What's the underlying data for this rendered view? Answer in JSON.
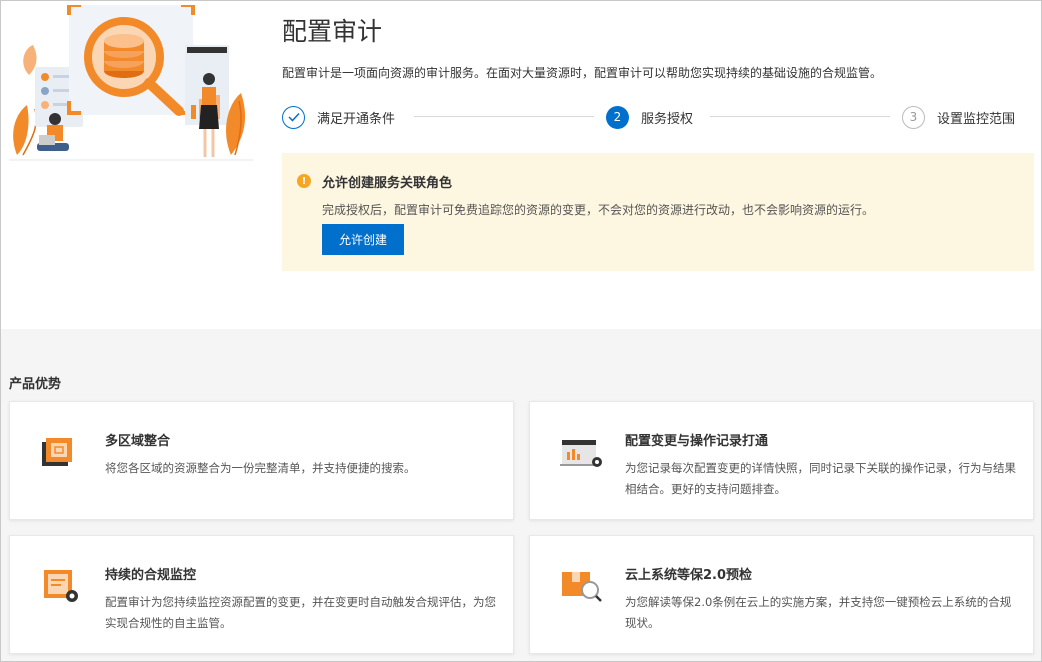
{
  "header": {
    "title": "配置审计",
    "description": "配置审计是一项面向资源的审计服务。在面对大量资源时，配置审计可以帮助您实现持续的基础设施的合规监管。"
  },
  "steps": [
    {
      "number": "1",
      "label": "满足开通条件",
      "state": "done"
    },
    {
      "number": "2",
      "label": "服务授权",
      "state": "active"
    },
    {
      "number": "3",
      "label": "设置监控范围",
      "state": "todo"
    }
  ],
  "notice": {
    "title": "允许创建服务关联角色",
    "text": "完成授权后，配置审计可免费追踪您的资源的变更，不会对您的资源进行改动，也不会影响资源的运行。",
    "button_label": "允许创建"
  },
  "advantages": {
    "title": "产品优势",
    "cards": [
      {
        "icon": "multi-region-icon",
        "title": "多区域整合",
        "desc": "将您各区域的资源整合为一份完整清单，并支持便捷的搜索。"
      },
      {
        "icon": "config-record-icon",
        "title": "配置变更与操作记录打通",
        "desc": "为您记录每次配置变更的详情快照，同时记录下关联的操作记录，行为与结果相结合。更好的支持问题排查。"
      },
      {
        "icon": "compliance-monitor-icon",
        "title": "持续的合规监控",
        "desc": "配置审计为您持续监控资源配置的变更，并在变更时自动触发合规评估，为您实现合规性的自主监管。"
      },
      {
        "icon": "security-check-icon",
        "title": "云上系统等保2.0预检",
        "desc": "为您解读等保2.0条例在云上的实施方案，并支持您一键预检云上系统的合规现状。"
      }
    ]
  },
  "colors": {
    "primary": "#0070cc",
    "accent_orange": "#f07c22",
    "notice_bg": "#fdf6e0",
    "warning": "#f5a623"
  }
}
